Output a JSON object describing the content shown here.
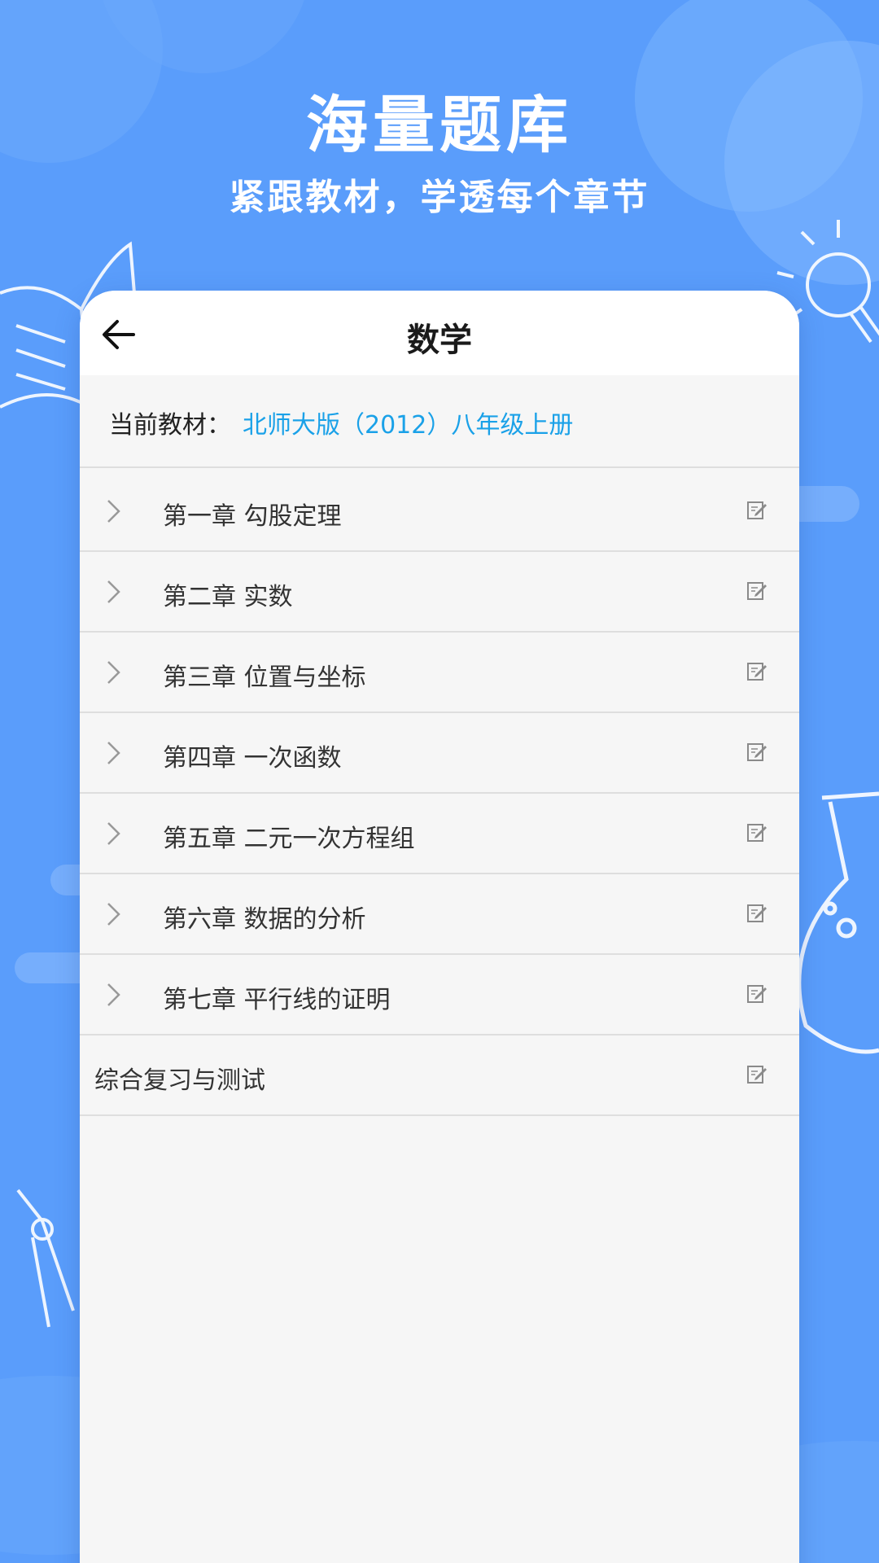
{
  "promo": {
    "title": "海量题库",
    "subtitle": "紧跟教材，学透每个章节"
  },
  "header": {
    "back_icon": "arrow-left-icon",
    "title": "数学"
  },
  "textbook": {
    "label": "当前教材：",
    "value": "北师大版（2012）八年级上册"
  },
  "chapters": [
    {
      "label": "第一章 勾股定理"
    },
    {
      "label": "第二章 实数"
    },
    {
      "label": "第三章 位置与坐标"
    },
    {
      "label": "第四章 一次函数"
    },
    {
      "label": "第五章 二元一次方程组"
    },
    {
      "label": "第六章 数据的分析"
    },
    {
      "label": "第七章 平行线的证明"
    }
  ],
  "review": {
    "label": "综合复习与测试"
  },
  "icons": {
    "chevron": "chevron-right-icon",
    "edit": "edit-icon"
  },
  "colors": {
    "background": "#5a9dfb",
    "accent_text": "#1aa1e8",
    "card": "#f6f6f6"
  }
}
